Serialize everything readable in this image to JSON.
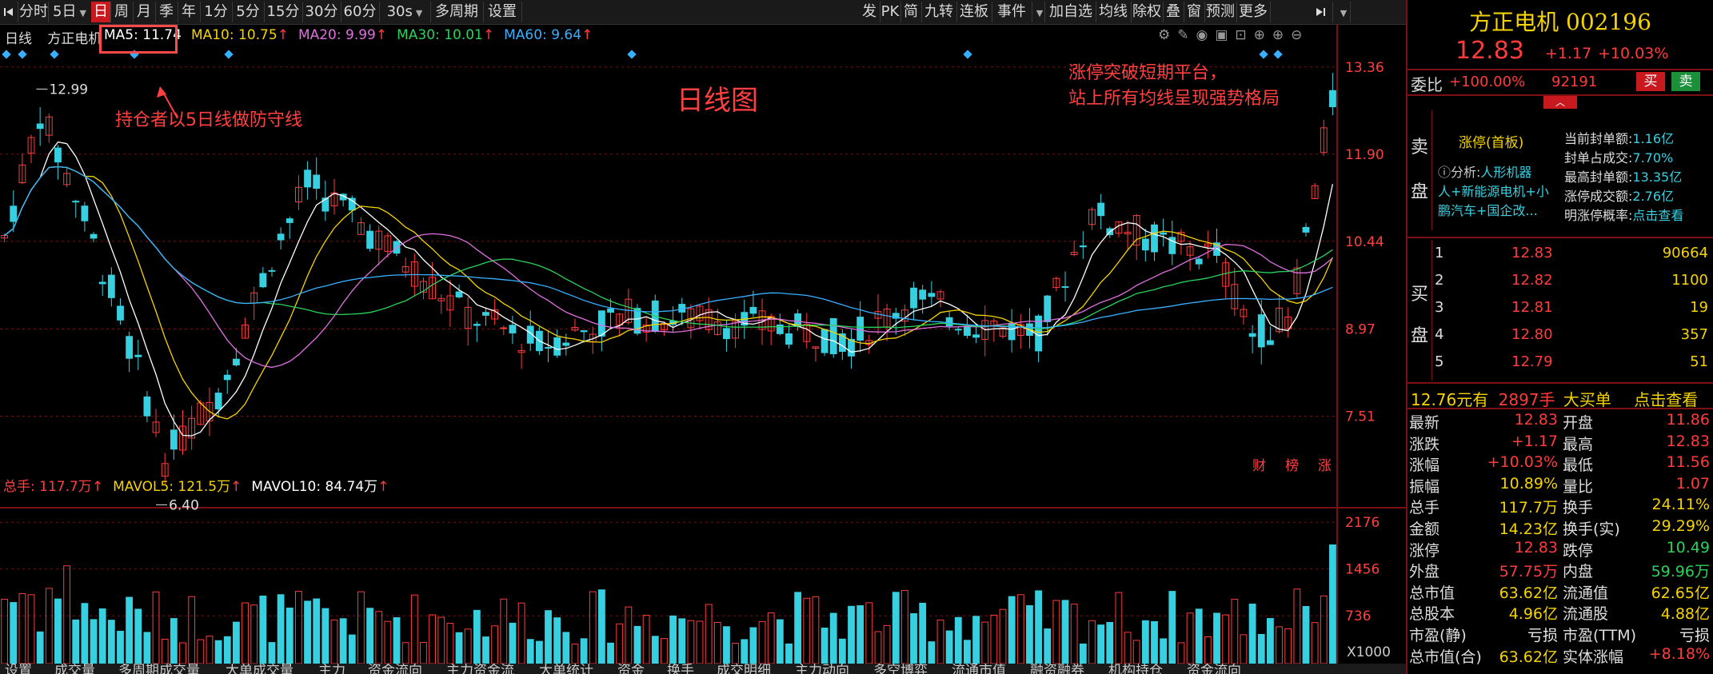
{
  "toolbar": {
    "left_items": [
      {
        "label": "分时",
        "active": false
      },
      {
        "label": "5日",
        "active": false,
        "dropdown": true
      },
      {
        "label": "日",
        "active": true
      },
      {
        "label": "周",
        "active": false
      },
      {
        "label": "月",
        "active": false
      },
      {
        "label": "季",
        "active": false
      },
      {
        "label": "年",
        "active": false
      },
      {
        "label": "1分",
        "active": false
      },
      {
        "label": "5分",
        "active": false
      },
      {
        "label": "15分",
        "active": false
      },
      {
        "label": "30分",
        "active": false
      },
      {
        "label": "60分",
        "active": false
      },
      {
        "label": "30s",
        "active": false,
        "dropdown": true
      },
      {
        "label": "多周期",
        "active": false
      },
      {
        "label": "设置",
        "active": false
      }
    ],
    "right_items": [
      "发",
      "PK",
      "简",
      "九转",
      "连板",
      "事件",
      "加自选",
      "均线",
      "除权",
      "叠",
      "窗",
      "预测",
      "更多"
    ]
  },
  "chart": {
    "period_label": "日线",
    "stock_label": "方正电机",
    "ma_legend": [
      {
        "name": "MA5",
        "value": "11.74",
        "arrow": "",
        "color": "#ffffff"
      },
      {
        "name": "MA10",
        "value": "10.75",
        "arrow": "↑",
        "color": "#f5d300"
      },
      {
        "name": "MA20",
        "value": "9.99",
        "arrow": "↑",
        "color": "#e070e0"
      },
      {
        "name": "MA30",
        "value": "10.01",
        "arrow": "↑",
        "color": "#2ad25c"
      },
      {
        "name": "MA60",
        "value": "9.64",
        "arrow": "↑",
        "color": "#37b0ff"
      }
    ],
    "price_ticks": [
      "13.36",
      "11.90",
      "10.44",
      "8.97",
      "7.51"
    ],
    "high_label": "12.99",
    "low_label": "6.40",
    "center_title": "日线图",
    "annotation_left": "持仓者以5日线做防守线",
    "annotation_right_1": "涨停突破短期平台，",
    "annotation_right_2": "站上所有均线呈现强势格局",
    "corner_tags": [
      "财",
      "榜",
      "涨"
    ]
  },
  "volume": {
    "legend": [
      {
        "name": "总手",
        "value": "117.7万",
        "arrow": "↑",
        "color": "#ff4040"
      },
      {
        "name": "MAVOL5",
        "value": "121.5万",
        "arrow": "↑",
        "color": "#f5d300"
      },
      {
        "name": "MAVOL10",
        "value": "84.74万",
        "arrow": "↑",
        "color": "#ffffff"
      }
    ],
    "ticks": [
      "2176",
      "1456",
      "736"
    ],
    "unit": "X1000"
  },
  "bottom_tabs": [
    "设置",
    "成交量",
    "多周期成交量",
    "大单成交量",
    "主力",
    "资金流向",
    "主力资金流",
    "大单统计",
    "资金",
    "换手",
    "成交明细",
    "主力动向",
    "多空博弈",
    "流通市值",
    "融资融券",
    "机构持仓",
    "资金流向"
  ],
  "panel": {
    "name": "方正电机",
    "code": "002196",
    "price": "12.83",
    "change": "+1.17",
    "change_pct": "+10.03%",
    "webi_label": "委比",
    "webi_value": "+100.00%",
    "webi_volume": "92191",
    "buy_button": "买",
    "sell_button": "卖",
    "limit_title": "涨停(首板)",
    "analysis_label": "分析:",
    "analysis_text_1": "人形机器",
    "analysis_text_2": "人+新能源电机+小",
    "analysis_text_3": "鹏汽车+国企改...",
    "seal_stats": [
      {
        "label": "当前封单额:",
        "value": "1.16亿"
      },
      {
        "label": "封单占成交:",
        "value": "7.70%"
      },
      {
        "label": "最高封单额:",
        "value": "13.35亿"
      },
      {
        "label": "涨停成交额:",
        "value": "2.76亿"
      },
      {
        "label": "明涨停概率:",
        "value": "点击查看"
      }
    ],
    "sell_side_label_1": "卖",
    "sell_side_label_2": "盘",
    "buy_side_label_1": "买",
    "buy_side_label_2": "盘",
    "bids": [
      {
        "level": "1",
        "price": "12.83",
        "vol": "90664"
      },
      {
        "level": "2",
        "price": "12.82",
        "vol": "1100"
      },
      {
        "level": "3",
        "price": "12.81",
        "vol": "19"
      },
      {
        "level": "4",
        "price": "12.80",
        "vol": "357"
      },
      {
        "level": "5",
        "price": "12.79",
        "vol": "51"
      }
    ],
    "bigorder_price": "12.76元有",
    "bigorder_vol": "2897手",
    "bigorder_label": "大买单",
    "bigorder_link": "点击查看",
    "stats_left": [
      {
        "label": "最新",
        "value": "12.83",
        "color": "red"
      },
      {
        "label": "涨跌",
        "value": "+1.17",
        "color": "red"
      },
      {
        "label": "涨幅",
        "value": "+10.03%",
        "color": "red"
      },
      {
        "label": "振幅",
        "value": "10.89%",
        "color": "yellow"
      },
      {
        "label": "总手",
        "value": "117.7万",
        "color": "yellow"
      },
      {
        "label": "金额",
        "value": "14.23亿",
        "color": "yellow"
      },
      {
        "label": "涨停",
        "value": "12.83",
        "color": "red"
      },
      {
        "label": "外盘",
        "value": "57.75万",
        "color": "red"
      },
      {
        "label": "总市值",
        "value": "63.62亿",
        "color": "yellow"
      },
      {
        "label": "总股本",
        "value": "4.96亿",
        "color": "yellow"
      },
      {
        "label": "市盈(静)",
        "value": "亏损",
        "color": "white"
      },
      {
        "label": "总市值(合)",
        "value": "63.62亿",
        "color": "yellow"
      }
    ],
    "stats_right": [
      {
        "label": "开盘",
        "value": "11.86",
        "color": "red"
      },
      {
        "label": "最高",
        "value": "12.83",
        "color": "red"
      },
      {
        "label": "最低",
        "value": "11.56",
        "color": "red"
      },
      {
        "label": "量比",
        "value": "1.07",
        "color": "red"
      },
      {
        "label": "换手",
        "value": "24.11%",
        "color": "yellow"
      },
      {
        "label": "换手(实)",
        "value": "29.29%",
        "color": "yellow"
      },
      {
        "label": "跌停",
        "value": "10.49",
        "color": "green"
      },
      {
        "label": "内盘",
        "value": "59.96万",
        "color": "green"
      },
      {
        "label": "流通值",
        "value": "62.65亿",
        "color": "yellow"
      },
      {
        "label": "流通股",
        "value": "4.88亿",
        "color": "yellow"
      },
      {
        "label": "市盈(TTM)",
        "value": "亏损",
        "color": "white"
      },
      {
        "label": "实体涨幅",
        "value": "+8.18%",
        "color": "red"
      }
    ]
  },
  "colors": {
    "up": "#ff3b3b",
    "down": "#37d0e0",
    "grid": "#7b0f14",
    "panel_border": "#7b0f14"
  }
}
